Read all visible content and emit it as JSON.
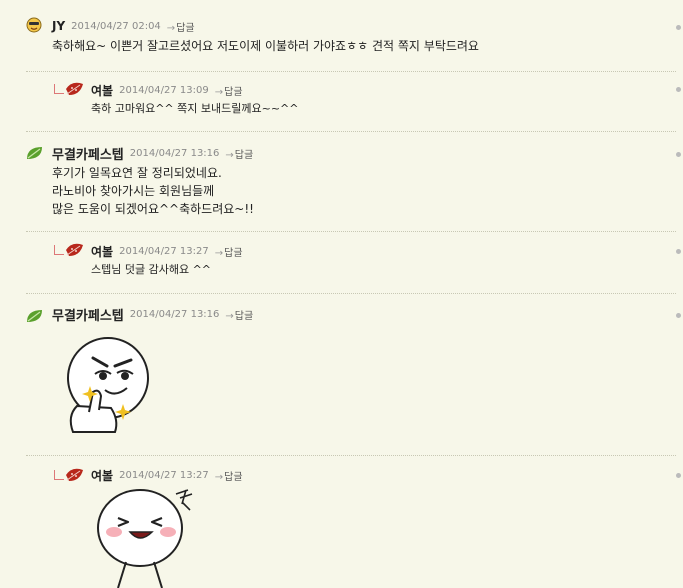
{
  "comments": [
    {
      "author": "JY",
      "date": "2014/04/27 02:04",
      "reply_label": "답글",
      "lines": [
        "축하해요~ 이쁜거 잘고르셨어요 저도이제 이불하러 가야죠ㅎㅎ 견적 쪽지 부탁드려요"
      ]
    },
    {
      "author": "여볼",
      "date": "2014/04/27 13:09",
      "reply_label": "답글",
      "lines": [
        "축하 고마워요^^ 쪽지 보내드릴께요~~^^"
      ]
    },
    {
      "author": "무결카페스텝",
      "date": "2014/04/27 13:16",
      "reply_label": "답글",
      "lines": [
        "후기가 일목요연 잘 정리되었네요.",
        "라노비아 찾아가시는 회원님들께",
        "많은 도움이 되겠어요^^축하드려요~!!"
      ]
    },
    {
      "author": "여볼",
      "date": "2014/04/27 13:27",
      "reply_label": "답글",
      "lines": [
        "스텝님 덧글 감사해요 ^^"
      ]
    },
    {
      "author": "무결카페스텝",
      "date": "2014/04/27 13:16",
      "reply_label": "답글",
      "sticker": "thumbs-up-sticker"
    },
    {
      "author": "여볼",
      "date": "2014/04/27 13:27",
      "reply_label": "답글",
      "sticker": "laughing-sticker"
    }
  ],
  "icons": {
    "arrow_glyph": "→",
    "emoji_avatar": "smiley-avatar-icon",
    "leaf_avatar": "leaf-avatar-icon",
    "leaf_red_avatar": "red-leaf-avatar-icon"
  },
  "colors": {
    "background": "#f7f7e9",
    "leaf_green": "#5aa02c",
    "leaf_red": "#b8281c"
  }
}
